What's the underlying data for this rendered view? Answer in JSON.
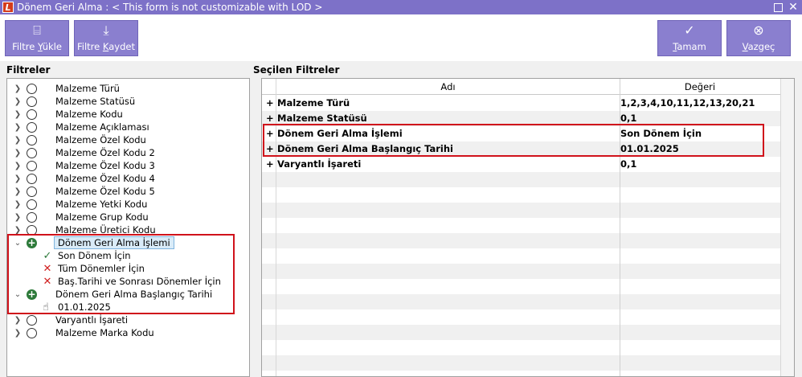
{
  "window": {
    "title": "Dönem Geri Alma : < This form is not customizable with LOD >",
    "logo_letter": "L"
  },
  "toolbar": {
    "filter_load": "Filtre Yükle",
    "filter_save": "Filtre Kaydet",
    "ok": "Tamam",
    "cancel": "Vazgeç"
  },
  "left": {
    "title": "Filtreler",
    "items": [
      "Malzeme Türü",
      "Malzeme Statüsü",
      "Malzeme Kodu",
      "Malzeme Açıklaması",
      "Malzeme Özel Kodu",
      "Malzeme Özel Kodu 2",
      "Malzeme Özel Kodu 3",
      "Malzeme Özel Kodu 4",
      "Malzeme Özel Kodu 5",
      "Malzeme Yetki Kodu",
      "Malzeme Grup Kodu",
      "Malzeme Üretici Kodu"
    ],
    "period_group": {
      "label": "Dönem Geri Alma İşlemi",
      "options": [
        "Son Dönem İçin",
        "Tüm Dönemler İçin",
        "Baş.Tarihi ve Sonrası Dönemler İçin"
      ]
    },
    "date_group": {
      "label": "Dönem Geri Alma Başlangıç Tarihi",
      "value": "01.01.2025"
    },
    "tail_items": [
      "Varyantlı İşareti",
      "Malzeme Marka Kodu"
    ]
  },
  "right": {
    "title": "Seçilen Filtreler",
    "col_name": "Adı",
    "col_value": "Değeri",
    "rows": [
      {
        "name": "Malzeme Türü",
        "value": "1,2,3,4,10,11,12,13,20,21"
      },
      {
        "name": "Malzeme Statüsü",
        "value": "0,1"
      },
      {
        "name": "Dönem Geri Alma İşlemi",
        "value": "Son Dönem İçin"
      },
      {
        "name": "Dönem Geri Alma Başlangıç Tarihi",
        "value": "01.01.2025"
      },
      {
        "name": "Varyantlı İşareti",
        "value": "0,1"
      }
    ],
    "plus": "+"
  }
}
